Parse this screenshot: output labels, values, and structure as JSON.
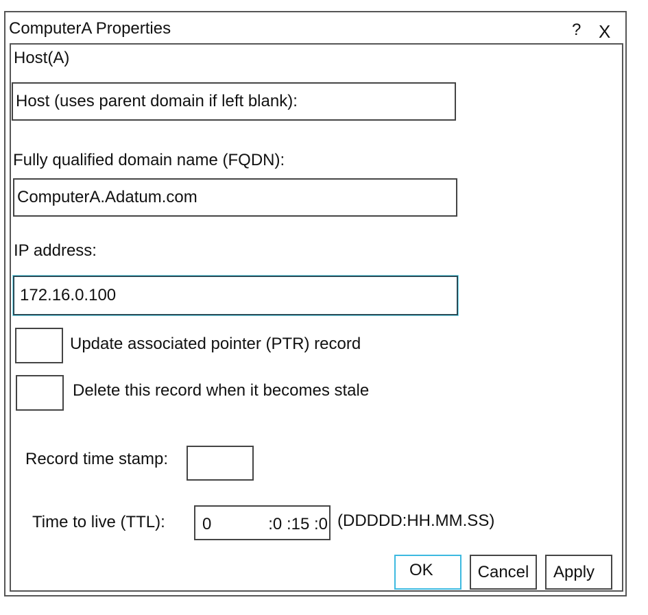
{
  "window": {
    "title": "ComputerA Properties",
    "help_glyph": "?",
    "close_glyph": "X"
  },
  "tab": {
    "label": "Host(A)"
  },
  "host": {
    "placeholder_text": "Host (uses parent domain if left blank):",
    "value": ""
  },
  "fqdn": {
    "label": "Fully qualified domain name (FQDN):",
    "value": "ComputerA.Adatum.com"
  },
  "ip": {
    "label": "IP address:",
    "value": "172.16.0.100",
    "focused": true,
    "focus_color": "#7fe3f5"
  },
  "checkboxes": [
    {
      "label": "Update associated pointer (PTR) record",
      "checked": false
    },
    {
      "label": "Delete this record when it becomes stale",
      "checked": false
    }
  ],
  "timestamp": {
    "label": "Record time stamp:",
    "value": ""
  },
  "ttl": {
    "label": "Time to live (TTL):",
    "days": "0",
    "rest": ":0 :15 :0",
    "format_hint": "(DDDDD:HH.MM.SS)"
  },
  "buttons": {
    "ok": "OK",
    "cancel": "Cancel",
    "apply": "Apply",
    "default_accent": "#3cb9e0"
  }
}
